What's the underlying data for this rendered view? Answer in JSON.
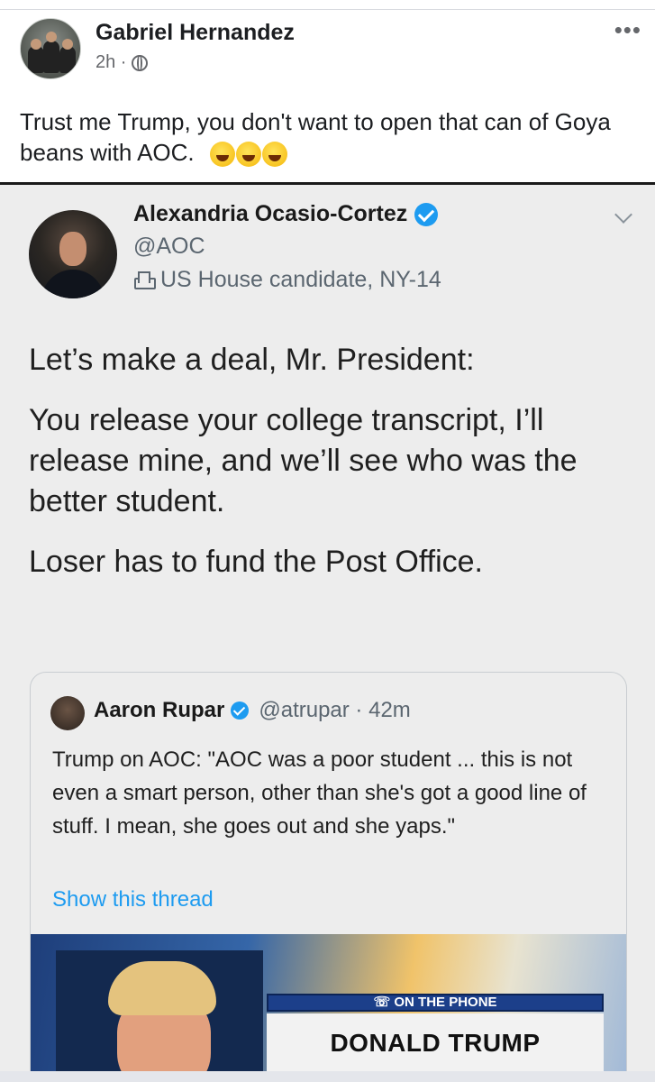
{
  "post": {
    "author": "Gabriel Hernandez",
    "time": "2h ·",
    "text": "Trust me Trump, you don't want to open that can of Goya beans with AOC.",
    "emojis": [
      "laughing-face",
      "rolling-on-floor-laughing-face",
      "tears-of-joy-face"
    ]
  },
  "tweet": {
    "name": "Alexandria Ocasio-Cortez",
    "handle": "@AOC",
    "bio": "US House candidate, NY-14",
    "paragraphs": [
      "Let’s make a deal, Mr. President:",
      "You release your college transcript, I’ll release mine, and we’ll see who was the better student.",
      "Loser has to fund the Post Office."
    ]
  },
  "quote": {
    "name": "Aaron Rupar",
    "handle": "@atrupar · 42m",
    "text": "Trump on AOC: \"AOC was a poor student ... this is not even a smart person, other than she's got a good line of stuff. I mean, she goes out and she yaps.\"",
    "show_thread": "Show this thread",
    "banner_top": "ON THE PHONE",
    "banner_name": "DONALD TRUMP"
  },
  "colors": {
    "verified": "#1d9bf0",
    "link": "#1d9bf0",
    "muted": "#5b6670"
  }
}
